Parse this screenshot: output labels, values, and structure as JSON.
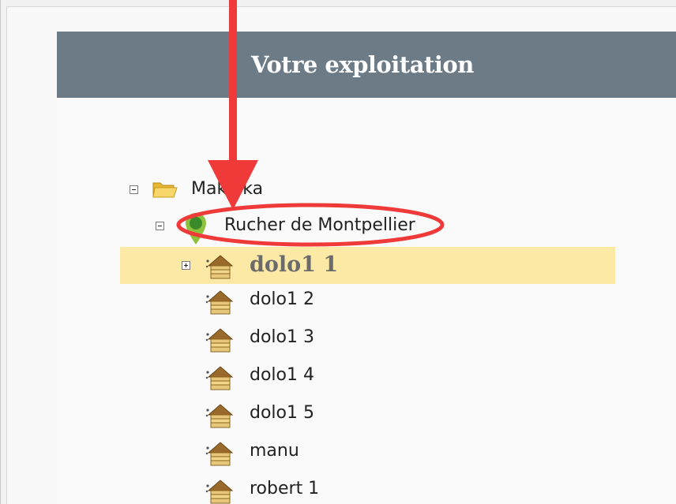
{
  "panel": {
    "title": "Votre exploitation",
    "header_color": "#6d7b86",
    "highlight_color": "#fde9a6"
  },
  "tree": {
    "root": {
      "label": "Makinka",
      "icon": "folder-open-icon",
      "expanded": true
    },
    "apiary": {
      "label": "Rucher de Montpellier",
      "icon": "map-pin-icon",
      "expanded": true
    },
    "hives": [
      {
        "label": "dolo1 1",
        "icon": "beehive-icon",
        "selected": true,
        "expandable": true
      },
      {
        "label": "dolo1 2",
        "icon": "beehive-icon",
        "selected": false,
        "expandable": false
      },
      {
        "label": "dolo1 3",
        "icon": "beehive-icon",
        "selected": false,
        "expandable": false
      },
      {
        "label": "dolo1 4",
        "icon": "beehive-icon",
        "selected": false,
        "expandable": false
      },
      {
        "label": "dolo1 5",
        "icon": "beehive-icon",
        "selected": false,
        "expandable": false
      },
      {
        "label": "manu",
        "icon": "beehive-icon",
        "selected": false,
        "expandable": false
      },
      {
        "label": "robert 1",
        "icon": "beehive-icon",
        "selected": false,
        "expandable": false
      }
    ]
  },
  "annotation": {
    "arrow_color": "#f03a3a",
    "ellipse_color": "#f03a3a"
  }
}
